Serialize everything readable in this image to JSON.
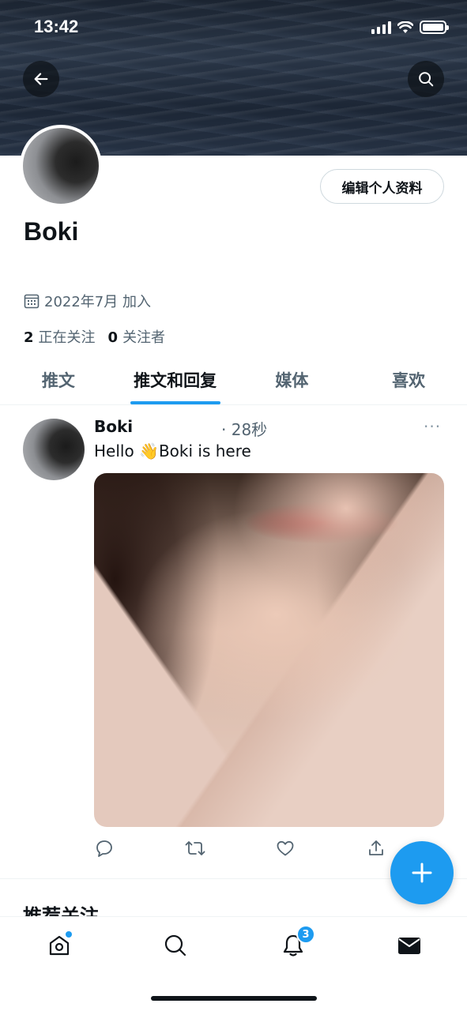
{
  "status_bar": {
    "time": "13:42"
  },
  "profile": {
    "display_name": "Boki",
    "edit_button_label": "编辑个人资料",
    "joined": "2022年7月 加入",
    "following_count": "2",
    "following_label": "正在关注",
    "followers_count": "0",
    "followers_label": "关注者"
  },
  "tabs": [
    {
      "label": "推文"
    },
    {
      "label": "推文和回复",
      "active": true
    },
    {
      "label": "媒体"
    },
    {
      "label": "喜欢"
    }
  ],
  "tweet": {
    "author": "Boki",
    "time": "· 28秒",
    "text": "Hello 👋Boki is here",
    "more": "···"
  },
  "section_peek": "推荐关注",
  "notifications_badge": "3",
  "colors": {
    "accent": "#1d9bf0",
    "text_primary": "#0f1419",
    "text_secondary": "#536471"
  }
}
